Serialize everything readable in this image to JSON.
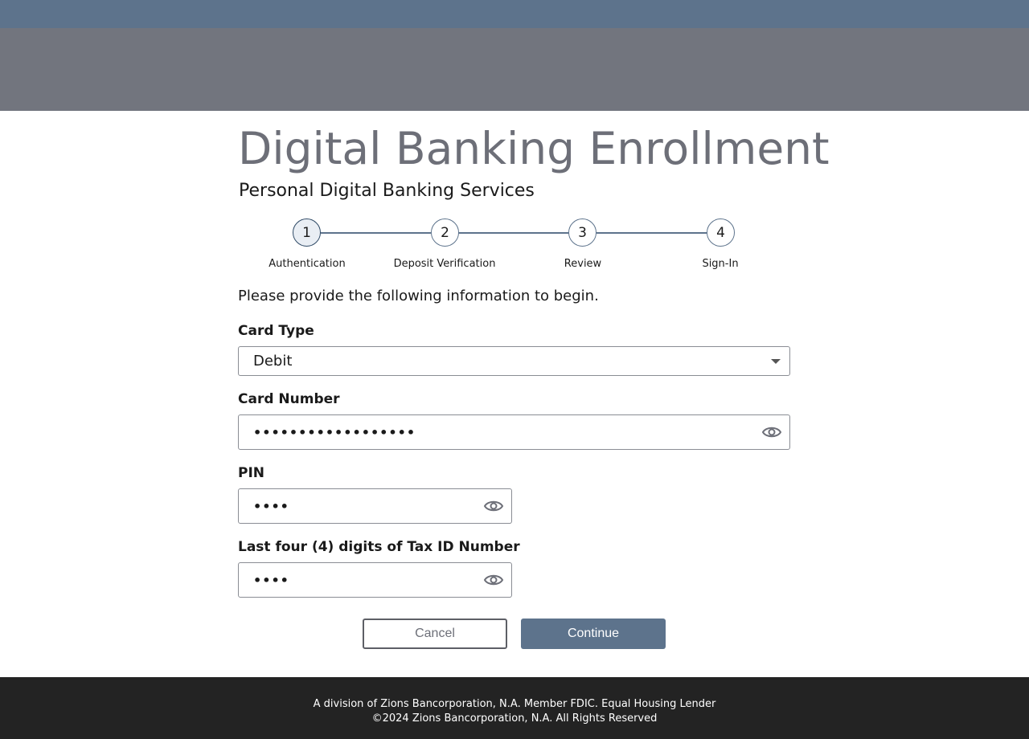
{
  "header": {
    "title": "Digital Banking Enrollment",
    "subtitle": "Personal Digital Banking Services"
  },
  "stepper": {
    "steps": [
      {
        "number": "1",
        "label": "Authentication",
        "active": true
      },
      {
        "number": "2",
        "label": "Deposit Verification",
        "active": false
      },
      {
        "number": "3",
        "label": "Review",
        "active": false
      },
      {
        "number": "4",
        "label": "Sign-In",
        "active": false
      }
    ]
  },
  "form": {
    "intro": "Please provide the following information to begin.",
    "card_type": {
      "label": "Card Type",
      "value": "Debit"
    },
    "card_number": {
      "label": "Card Number",
      "value": "••••••••••••••••••",
      "icon": "eye-icon"
    },
    "pin": {
      "label": "PIN",
      "value": "••••",
      "icon": "eye-icon"
    },
    "tax_id": {
      "label": "Last four (4) digits of Tax ID Number",
      "value": "••••",
      "icon": "eye-icon"
    }
  },
  "actions": {
    "cancel_label": "Cancel",
    "continue_label": "Continue"
  },
  "footer": {
    "line1": "A division of Zions Bancorporation, N.A. Member FDIC. Equal Housing Lender",
    "line2": "©2024 Zions Bancorporation, N.A. All Rights Reserved"
  },
  "colors": {
    "top_band": "#5d738c",
    "header_band": "#72757e",
    "accent": "#5d738c",
    "footer_bg": "#232323"
  }
}
